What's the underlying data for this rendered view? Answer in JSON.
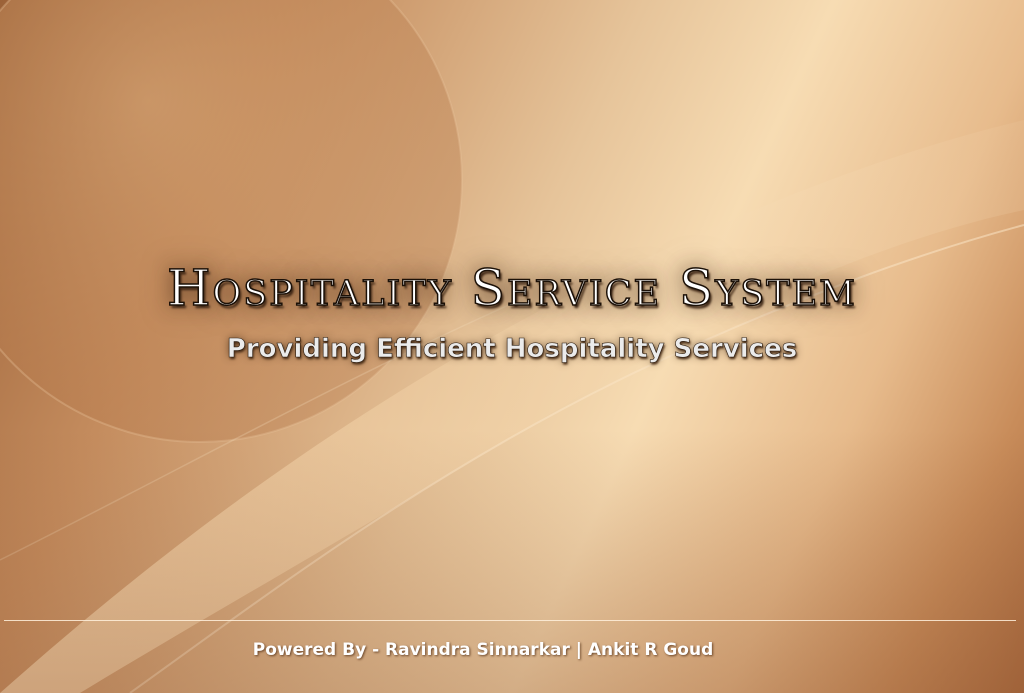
{
  "splash": {
    "title": "Hospitality Service System",
    "subtitle": "Providing Efficient Hospitality Services",
    "footer": "Powered By - Ravindra Sinnarkar | Ankit R Goud"
  },
  "colors": {
    "background_dark": "#9c6238",
    "background_light": "#f7dcb3",
    "title_text": "#ffffff",
    "title_outline": "#1c1108",
    "subtitle_text": "#ebebeb",
    "footer_text": "#ffffff"
  }
}
